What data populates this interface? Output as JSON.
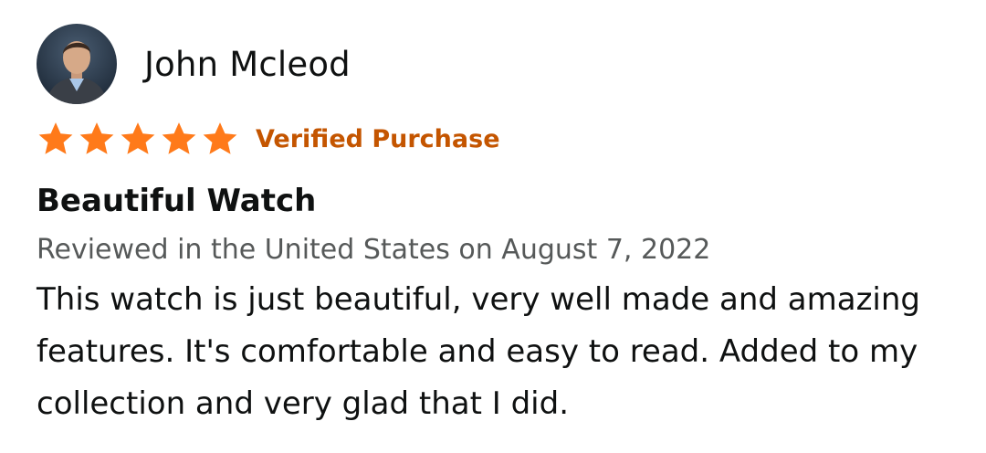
{
  "review": {
    "reviewer_name": "John Mcleod",
    "avatar": "reviewer-profile-photo",
    "rating": {
      "value": 5,
      "max": 5,
      "star_color": "#ff7a1a"
    },
    "verified_label": "Verified Purchase",
    "verified_color": "#c45500",
    "title": "Beautiful Watch",
    "date_line": "Reviewed in the United States on August 7, 2022",
    "body": "This watch is just beautiful, very well made and amazing features. It's comfortable and easy to read. Added to my collection and very glad that I did."
  }
}
